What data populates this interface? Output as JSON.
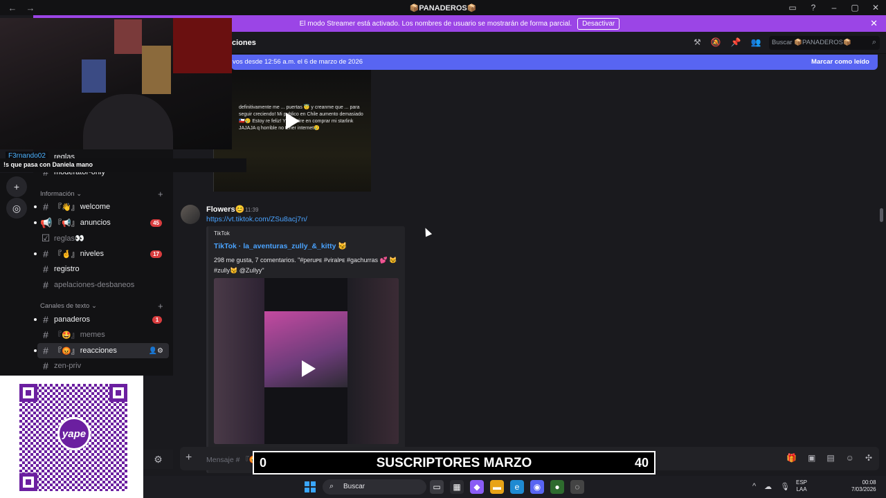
{
  "titlebar": {
    "title": "📦PANADEROS📦",
    "back": "←",
    "forward": "→"
  },
  "streamer": {
    "message": "El modo Streamer está activado. Los nombres de usuario se mostrarán de forma parcial.",
    "deactivate": "Desactivar",
    "close": "✕"
  },
  "overlay": {
    "username": "F3rnando02",
    "message": "!s que pasa con Daniela mano"
  },
  "header": {
    "channel_name": "ciones",
    "search_placeholder": "Buscar 📦PANADEROS📦"
  },
  "new_messages": {
    "since": "vos desde 12:56 a.m. el 6 de marzo de 2026",
    "mark_read": "Marcar como leído"
  },
  "old_video": {
    "text": "definitivamente me ... puertas 😇 y creanme que ... para seguir creciendo! Mi publico en Chile aumento demasiado 🇨🇱🥲 Estoy re feliz! Y invertire en comprar mi starlink JAJAJA q horrible no tener internet🥲"
  },
  "sidebar": {
    "top_channels": [
      {
        "label": "reglas",
        "prefix": "『",
        "suffix": "』"
      },
      {
        "label": "moderator-only"
      }
    ],
    "categories": [
      {
        "name": "Información",
        "chevron": "⌄"
      },
      {
        "name": "Canales de texto",
        "chevron": "⌄"
      }
    ],
    "channels": [
      {
        "label": "welcome",
        "emoji": "『👋』",
        "type": "hash"
      },
      {
        "label": "anuncios",
        "emoji": "『📢』",
        "type": "megaphone",
        "badge": "45"
      },
      {
        "label": "reglas👀",
        "type": "rules"
      },
      {
        "label": "niveles",
        "emoji": "『🤞』",
        "type": "hash",
        "badge": "17"
      },
      {
        "label": "registro",
        "type": "hash"
      },
      {
        "label": "apelaciones-desbaneos",
        "type": "hash"
      },
      {
        "label": "panaderos",
        "type": "hash",
        "badge": "1"
      },
      {
        "label": "memes",
        "emoji": "『🤩』",
        "type": "hash"
      },
      {
        "label": "reacciones",
        "emoji": "『😡』",
        "type": "hash"
      },
      {
        "label": "zen-priv",
        "type": "hash"
      }
    ]
  },
  "qr": {
    "brand": "yape",
    "badge": "S/"
  },
  "message": {
    "author": "Flowers😊",
    "time": "11:39",
    "link": "https://vt.tiktok.com/ZSu8acj7n/",
    "embed": {
      "provider": "TikTok",
      "title": "TikTok · la_aventuras_zully_&_kitty 😼",
      "description": "298 me gusta, 7 comentarios. \"#peruᴘᴇ #viralᴘᴇ #gachurras 💕 😼 #zully😼 @Zullyy\""
    }
  },
  "composer": {
    "placeholder": "Mensaje # 『😡』reacciones",
    "plus": "+"
  },
  "subs": {
    "left": "0",
    "title": "SUSCRIPTORES MARZO",
    "right": "40"
  },
  "taskbar": {
    "search": "Buscar",
    "lang1": "ESP",
    "lang2": "LAA",
    "time": "00:08",
    "date": "7/03/2026"
  },
  "colors": {
    "accent": "#5865f2",
    "streamer": "#9b45e6",
    "link": "#4aa3ff",
    "badge": "#d83c3e"
  }
}
